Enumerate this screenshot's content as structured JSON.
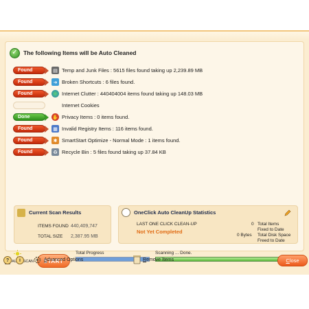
{
  "header": {
    "title": "The following Items will be Auto Cleaned"
  },
  "items": [
    {
      "status": "Found",
      "icon": "trash-icon",
      "text": "Temp and Junk Files : 5615 files found taking up 2,239.89 MB"
    },
    {
      "status": "Found",
      "icon": "shortcut-arrow-icon",
      "text": "Broken Shortcuts : 6 files found."
    },
    {
      "status": "Found",
      "icon": "globe-icon",
      "text": "Internet Clutter : 440404004 items found taking up 148.03 MB"
    },
    {
      "status": "",
      "icon": "",
      "text": "Internet Cookies"
    },
    {
      "status": "Done",
      "icon": "privacy-shield-icon",
      "text": "Privacy Items : 0 items found."
    },
    {
      "status": "Found",
      "icon": "registry-grid-icon",
      "text": "Invalid Registry Items : 116 items found."
    },
    {
      "status": "Found",
      "icon": "startup-gear-icon",
      "text": "SmartStart Optimize - Normal Mode : 1 items found."
    },
    {
      "status": "Found",
      "icon": "recycle-bin-icon",
      "text": "Recycle Bin : 5 files found taking up 37.84 KB"
    }
  ],
  "current_scan": {
    "title": "Current Scan Results",
    "items_found_label": "ITEMS FOUND",
    "items_found_value": "440,409,747",
    "total_size_label": "TOTAL SIZE",
    "total_size_value": "2,387.95 MB"
  },
  "oneclick": {
    "title": "OneClick Auto CleanUp Statistics",
    "last_label": "LAST ONE CLICK CLEAN-UP",
    "last_value": "Not Yet Completed",
    "items_count": "0",
    "items_label_1": "Total Items",
    "items_label_2": "Fixed to Date",
    "bytes_count": "0 Bytes",
    "bytes_label_1": "Total Disk Space",
    "bytes_label_2": "Freed to Date"
  },
  "controls": {
    "auto_scan_label": "AUTO SCAN",
    "auto_scan_checked": true,
    "start_label": "START",
    "total_progress_label": "Total Progress",
    "total_progress": 1.0,
    "scanning_label": "Scanning ... Done.",
    "scanning_progress": 1.0
  },
  "footer": {
    "help_label": "?",
    "info_label": "i",
    "advanced_first": "A",
    "advanced_rest": "dvanced Options",
    "remove_first": "R",
    "remove_rest": "emove Items",
    "close_first": "C",
    "close_rest": "lose"
  },
  "colors": {
    "found": "#d8391a",
    "done": "#3c9d27",
    "not_completed": "#e06a12",
    "accent": "#f06a26"
  }
}
